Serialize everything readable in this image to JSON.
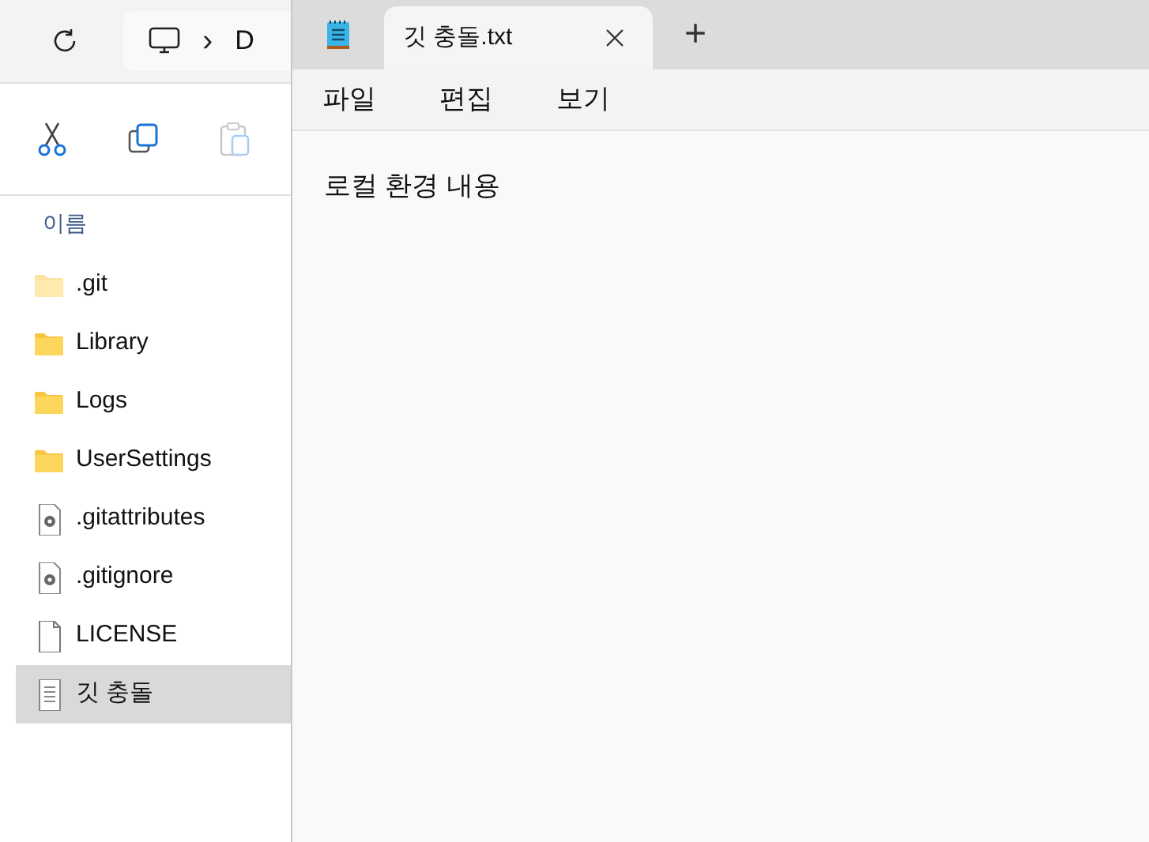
{
  "explorer": {
    "address": {
      "separator": "›",
      "segment": "D"
    },
    "column_header": "이름",
    "files": [
      {
        "name": ".git",
        "kind": "folder",
        "hidden": true,
        "selected": false
      },
      {
        "name": "Library",
        "kind": "folder",
        "hidden": false,
        "selected": false
      },
      {
        "name": "Logs",
        "kind": "folder",
        "hidden": false,
        "selected": false
      },
      {
        "name": "UserSettings",
        "kind": "folder",
        "hidden": false,
        "selected": false
      },
      {
        "name": ".gitattributes",
        "kind": "config",
        "hidden": false,
        "selected": false
      },
      {
        "name": ".gitignore",
        "kind": "config",
        "hidden": false,
        "selected": false
      },
      {
        "name": "LICENSE",
        "kind": "file",
        "hidden": false,
        "selected": false
      },
      {
        "name": "깃 충돌",
        "kind": "text",
        "hidden": false,
        "selected": true
      }
    ]
  },
  "notepad": {
    "tabs": [
      {
        "title": "깃 충돌.txt",
        "selected": true
      }
    ],
    "new_tab": "+",
    "menu": [
      "파일",
      "편집",
      "보기"
    ],
    "content": "로컬 환경 내용"
  }
}
